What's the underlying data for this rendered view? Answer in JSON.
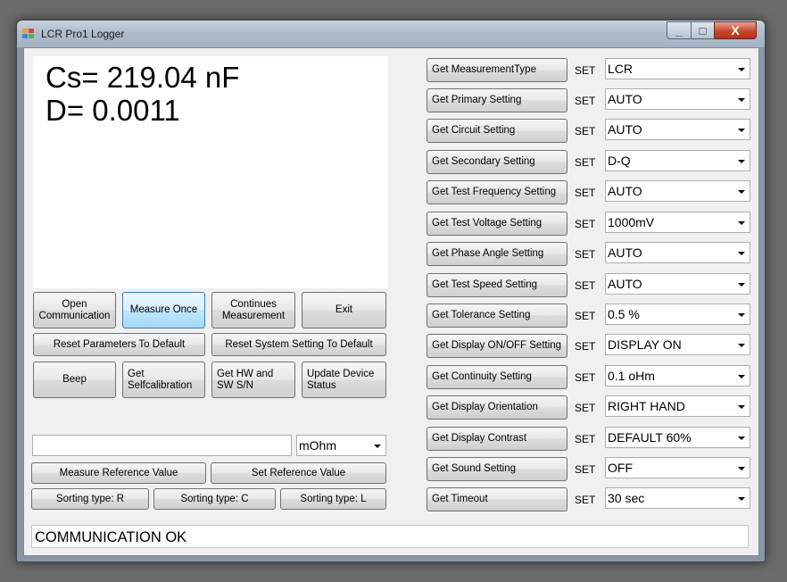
{
  "window": {
    "title": "LCR Pro1 Logger",
    "controls": {
      "minimize": "_",
      "maximize": "□",
      "close": "X"
    }
  },
  "display": {
    "line1": "Cs= 219.04 nF",
    "line2": "D= 0.0011"
  },
  "buttons": {
    "open_communication": "Open Communication",
    "measure_once": "Measure Once",
    "continues_measurement": "Continues Measurement",
    "exit": "Exit",
    "reset_parameters": "Reset Parameters To Default",
    "reset_system": "Reset System Setting To Default",
    "beep": "Beep",
    "get_selfcalibration": "Get Selfcalibration",
    "get_hw_sw": "Get HW and SW S/N",
    "update_device_status": "Update Device Status",
    "measure_reference": "Measure Reference Value",
    "set_reference": "Set Reference Value",
    "sort_r": "Sorting type: R",
    "sort_c": "Sorting type: C",
    "sort_l": "Sorting type: L"
  },
  "reference": {
    "value": "",
    "unit": "mOhm"
  },
  "set_label": "SET",
  "settings": [
    {
      "button": "Get MeasurementType",
      "value": "LCR"
    },
    {
      "button": "Get Primary Setting",
      "value": "AUTO"
    },
    {
      "button": "Get Circuit Setting",
      "value": "AUTO"
    },
    {
      "button": "Get Secondary Setting",
      "value": "D-Q"
    },
    {
      "button": "Get Test Frequency Setting",
      "value": "AUTO"
    },
    {
      "button": "Get Test Voltage Setting",
      "value": "1000mV"
    },
    {
      "button": "Get Phase Angle Setting",
      "value": "AUTO"
    },
    {
      "button": "Get Test Speed Setting",
      "value": "AUTO"
    },
    {
      "button": "Get Tolerance Setting",
      "value": "0.5 %"
    },
    {
      "button": "Get Display ON/OFF Setting",
      "value": "DISPLAY ON"
    },
    {
      "button": "Get Continuity Setting",
      "value": "0.1 oHm"
    },
    {
      "button": "Get Display Orientation",
      "value": "RIGHT HAND"
    },
    {
      "button": "Get Display Contrast",
      "value": "DEFAULT 60%"
    },
    {
      "button": "Get Sound Setting",
      "value": "OFF"
    },
    {
      "button": "Get Timeout",
      "value": "30 sec"
    }
  ],
  "status": "COMMUNICATION OK",
  "colors": {
    "hover_button": "#bee6fd",
    "close_button": "#c8462d"
  }
}
